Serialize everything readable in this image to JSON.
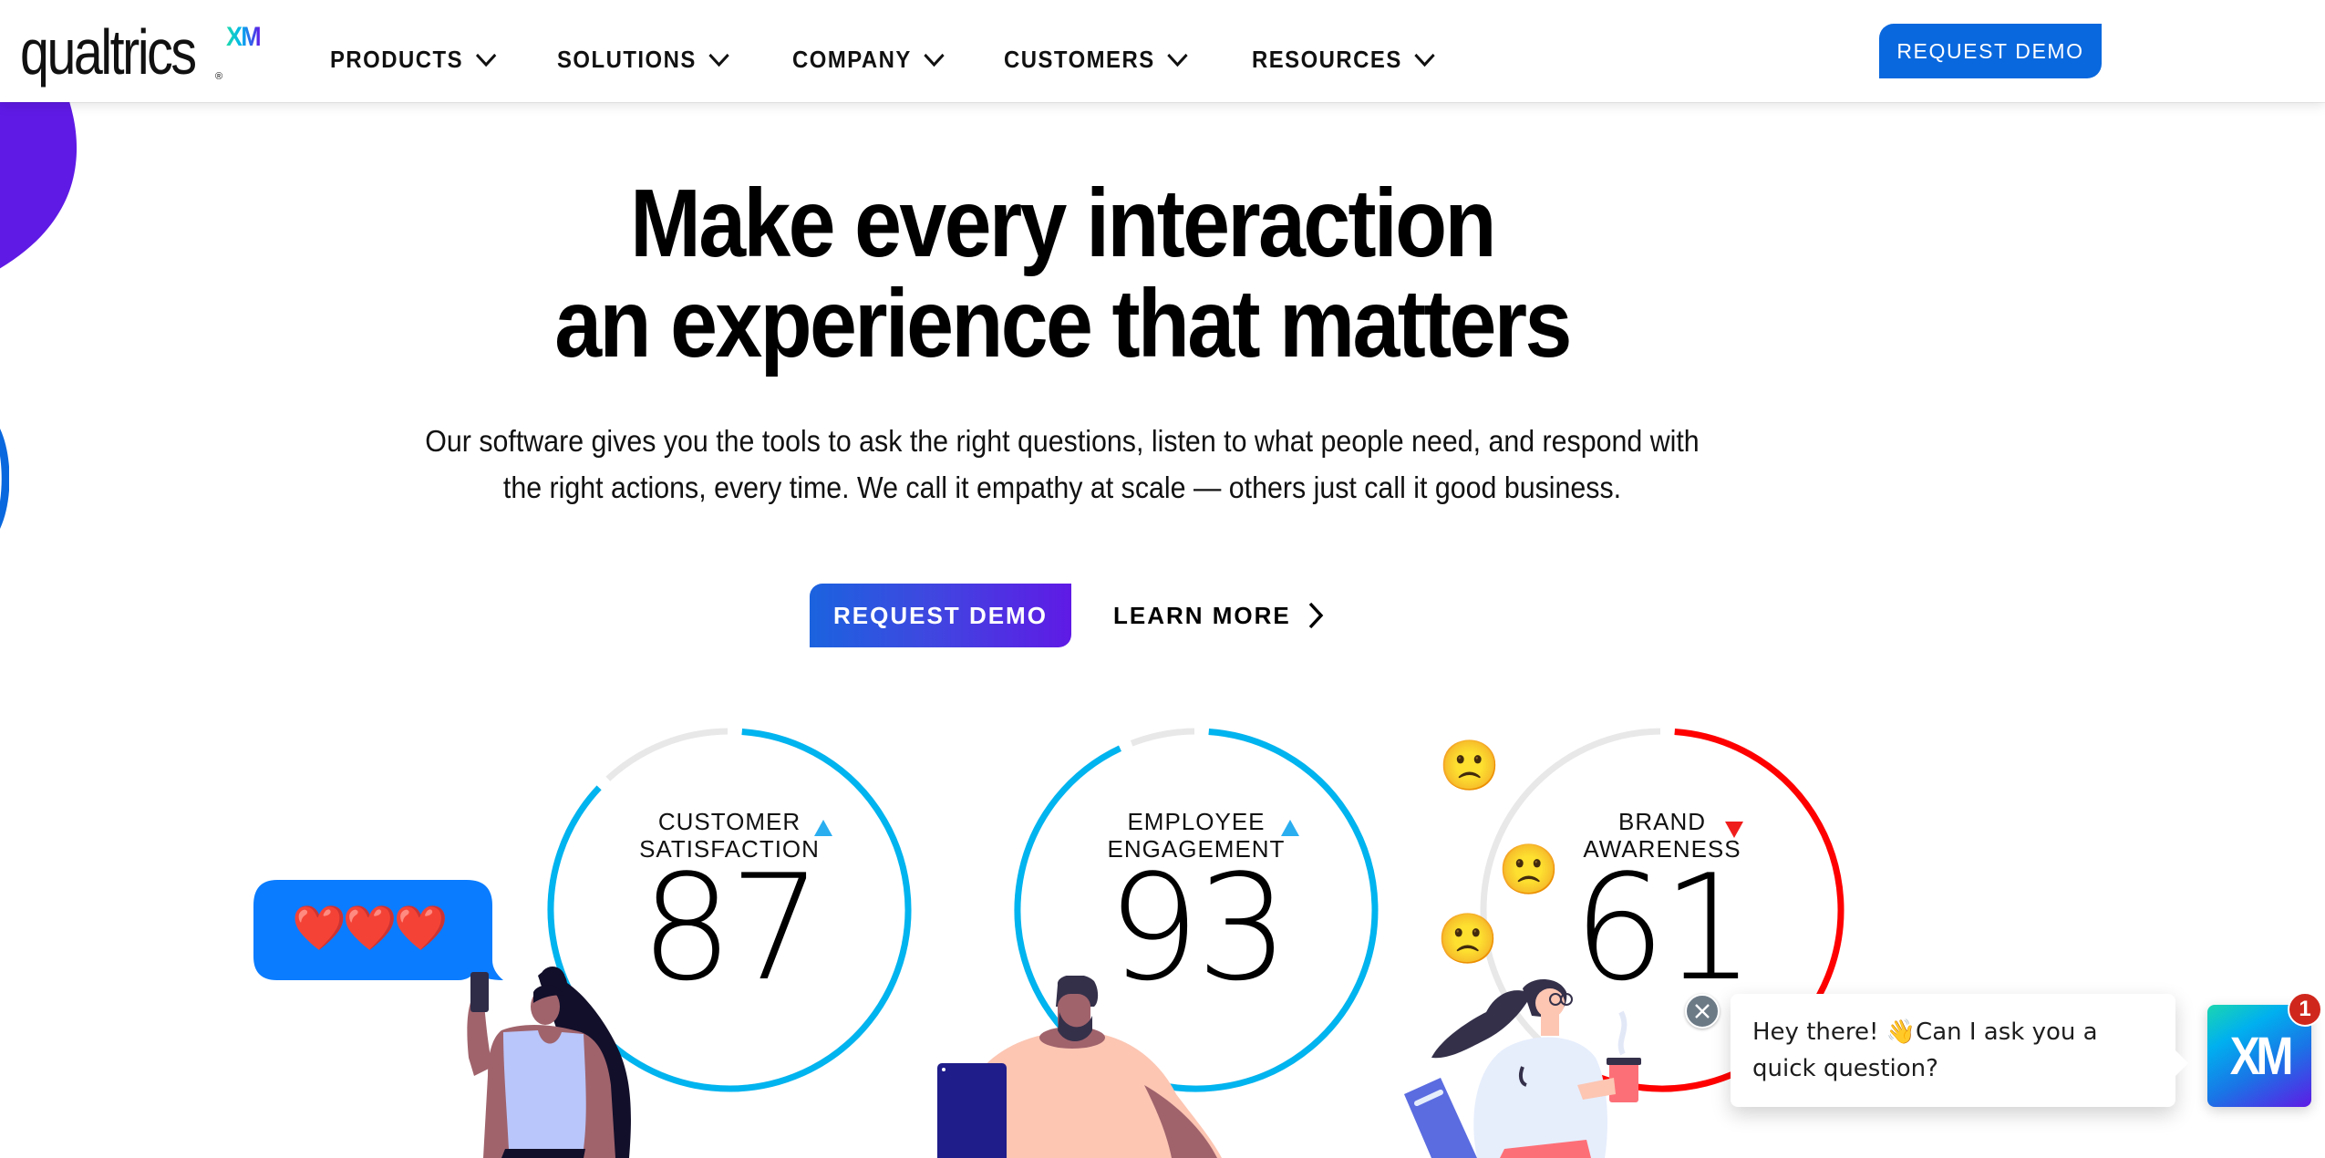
{
  "header": {
    "logo_text": "qualtrics",
    "logo_superscript": "XM",
    "logo_registered": "®",
    "nav": [
      {
        "label": "PRODUCTS",
        "icon": "chevron-down-icon"
      },
      {
        "label": "SOLUTIONS",
        "icon": "chevron-down-icon"
      },
      {
        "label": "COMPANY",
        "icon": "chevron-down-icon"
      },
      {
        "label": "CUSTOMERS",
        "icon": "chevron-down-icon"
      },
      {
        "label": "RESOURCES",
        "icon": "chevron-down-icon"
      }
    ],
    "request_demo_label": "REQUEST DEMO"
  },
  "hero": {
    "title_line1": "Make every interaction",
    "title_line2": "an experience that matters",
    "subtitle_line1": "Our software gives you the tools to ask the right questions, listen to what people need, and respond with",
    "subtitle_line2": "the right actions, every time. We call it empathy at scale — others just call it good business.",
    "cta_primary": "REQUEST DEMO",
    "cta_secondary": "LEARN MORE"
  },
  "metrics": [
    {
      "label_line1": "CUSTOMER",
      "label_line2": "SATISFACTION",
      "value": "87",
      "percent": 87,
      "trend": "up",
      "color": "#00b4ef"
    },
    {
      "label_line1": "EMPLOYEE",
      "label_line2": "ENGAGEMENT",
      "value": "93",
      "percent": 93,
      "trend": "up",
      "color": "#00b4ef"
    },
    {
      "label_line1": "BRAND",
      "label_line2": "AWARENESS",
      "value": "61",
      "percent": 61,
      "trend": "down",
      "color": "#ff0000"
    }
  ],
  "trend_colors": {
    "up": "#2aaef0",
    "down": "#f01d1d"
  },
  "decorations": {
    "hearts": "❤️❤️❤️",
    "sad_emoji": "🙁"
  },
  "chat": {
    "message_part1": "Hey there! ",
    "wave_emoji": "👋",
    "message_part2": "Can I ask you a quick question?",
    "launcher_label": "XM",
    "unread_count": "1"
  },
  "colors": {
    "brand_blue": "#0a68de",
    "brand_purple": "#5f1ae5",
    "track_gray": "#e8e8e8"
  }
}
